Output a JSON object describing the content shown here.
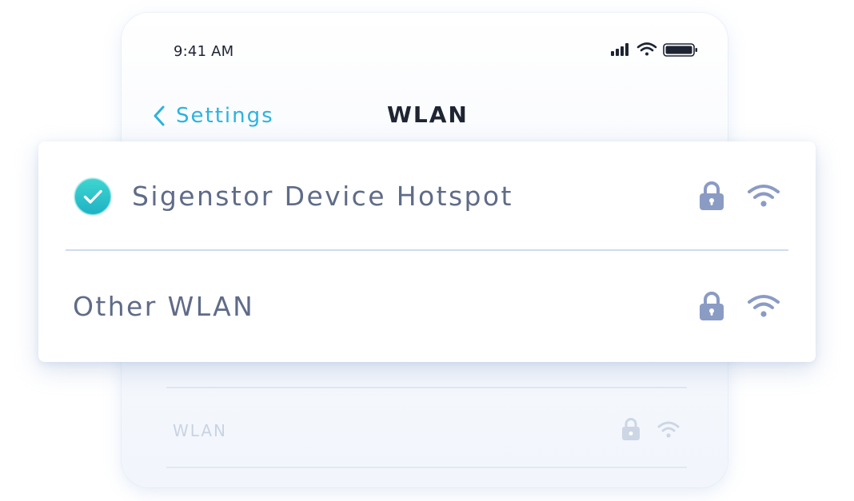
{
  "status_bar": {
    "time": "9:41 AM",
    "icons": [
      "cellular-signal-icon",
      "wifi-icon",
      "battery-icon"
    ]
  },
  "nav": {
    "back_label": "Settings",
    "title": "WLAN"
  },
  "networks": [
    {
      "name": "Sigenstor Device Hotspot",
      "connected": true,
      "secured": true
    },
    {
      "name": "Other WLAN",
      "connected": false,
      "secured": true
    }
  ],
  "background_list": [
    {
      "name": "WLAN",
      "secured": true
    }
  ],
  "colors": {
    "accent": "#2bb3e0",
    "check": "#22c1c8",
    "label": "#5f6b88",
    "icon": "#8a9bc4"
  }
}
